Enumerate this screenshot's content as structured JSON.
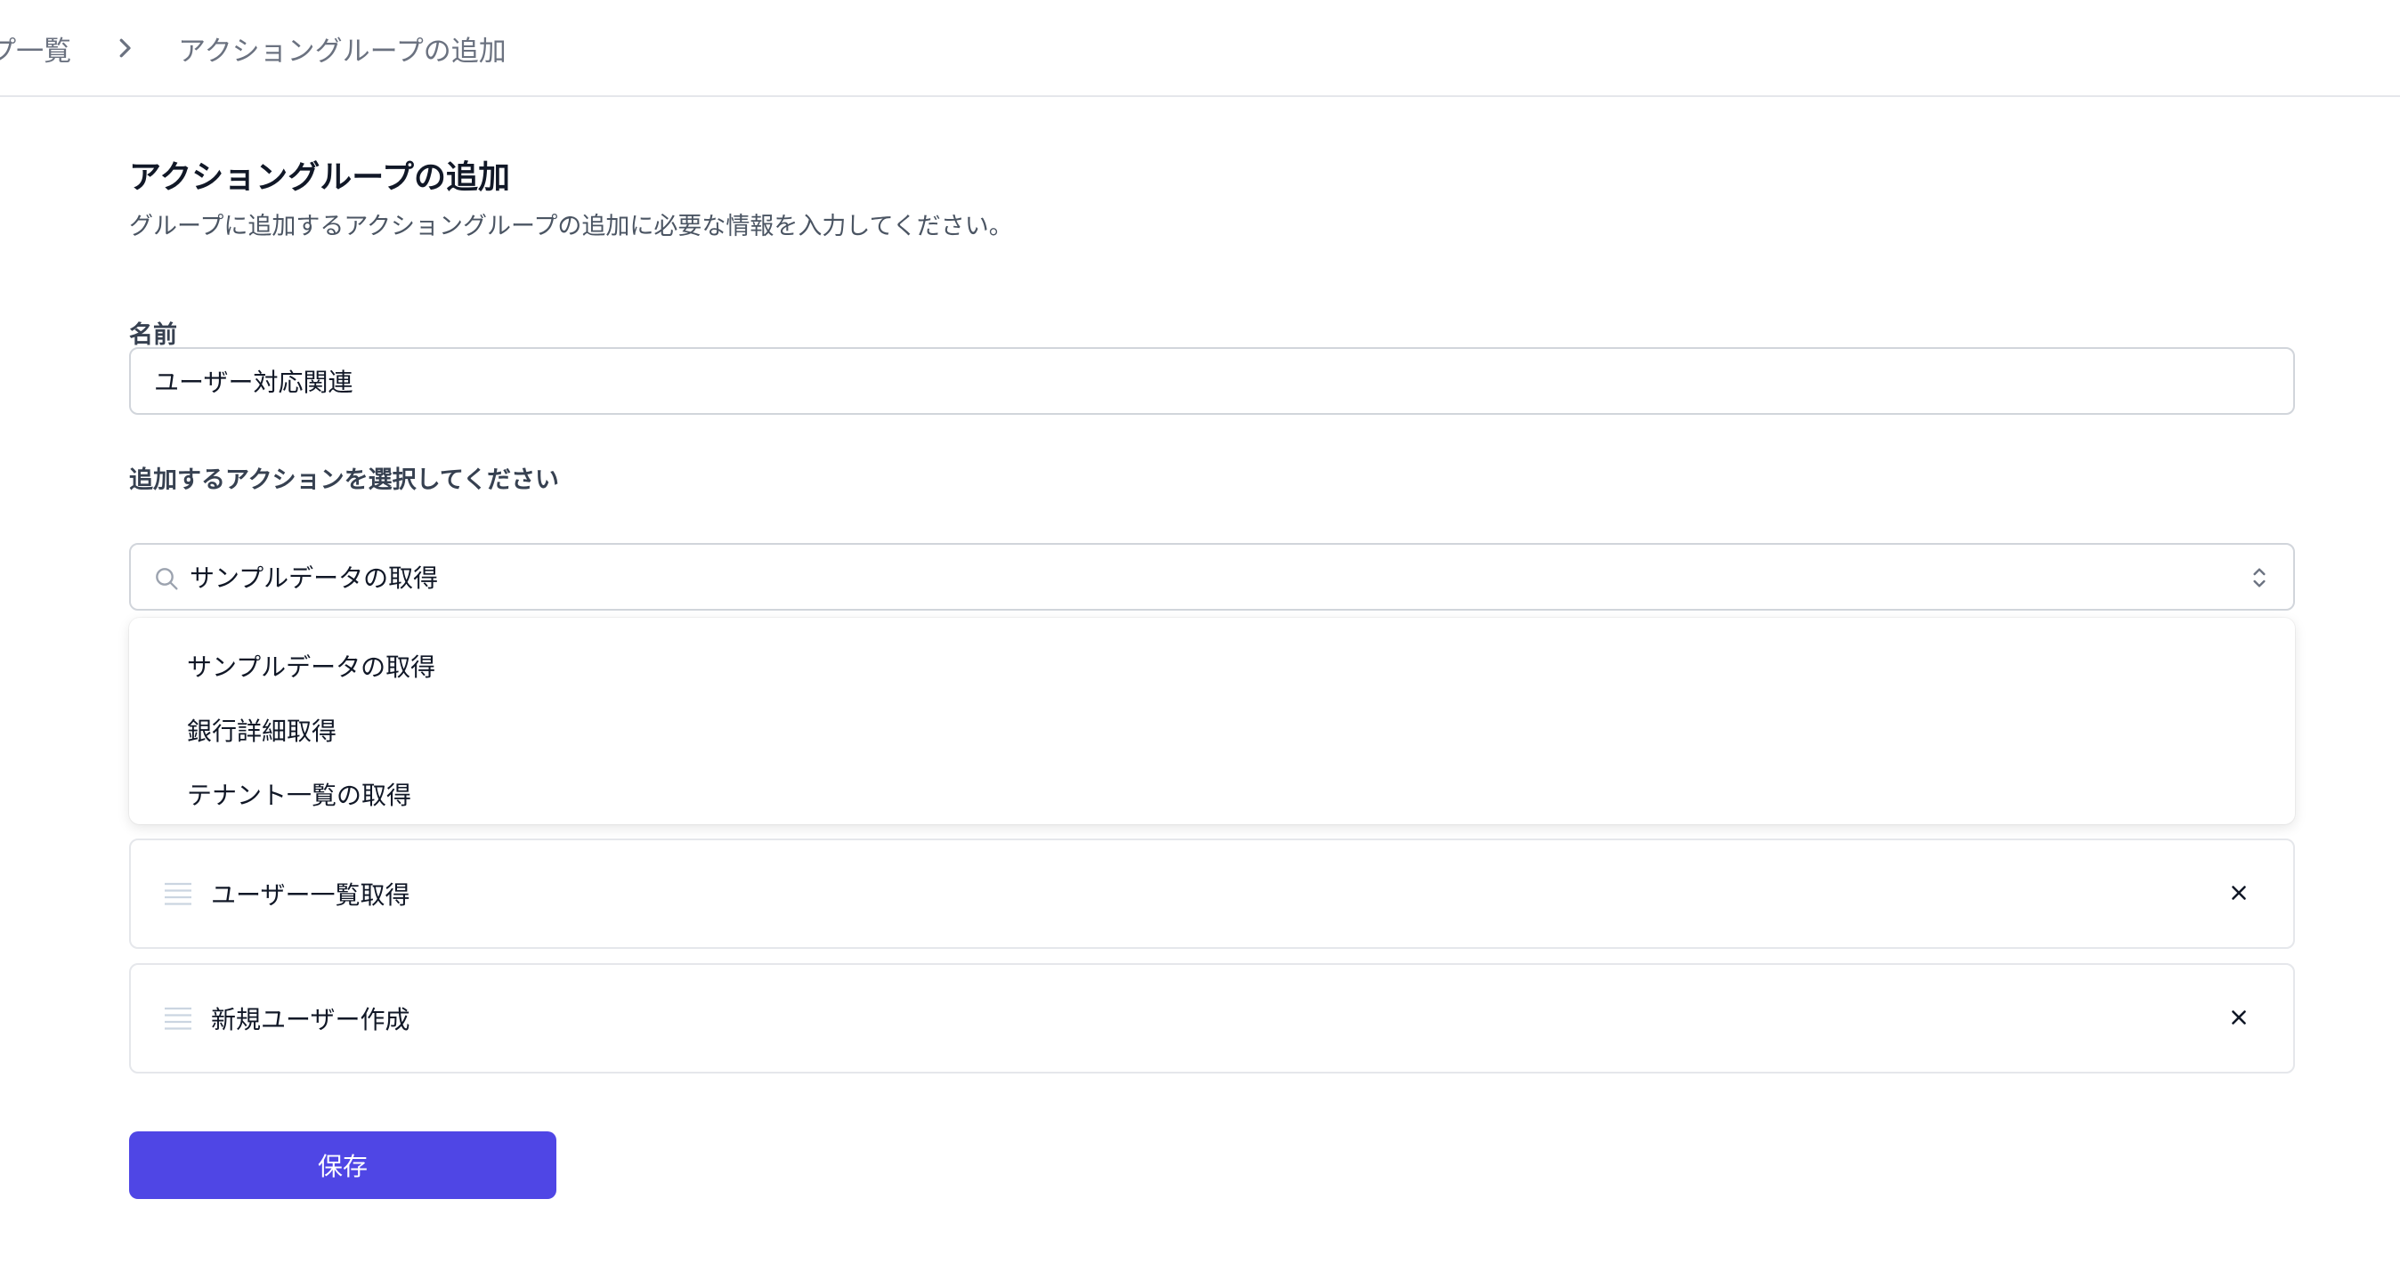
{
  "breadcrumb": {
    "items": [
      "ープ一覧",
      "アクショングループの追加"
    ]
  },
  "page": {
    "title": "アクショングループの追加",
    "description": "グループに追加するアクショングループの追加に必要な情報を入力してください。"
  },
  "form": {
    "name_label": "名前",
    "name_value": "ユーザー対応関連",
    "select_label": "追加するアクションを選択してください",
    "search_value": "サンプルデータの取得",
    "options": [
      "サンプルデータの取得",
      "銀行詳細取得",
      "テナント一覧の取得"
    ],
    "selected_actions": [
      "ユーザー一覧取得",
      "新規ユーザー作成"
    ],
    "save_label": "保存"
  },
  "icons": {
    "breadcrumb_separator": "chevron-right-icon",
    "search": "search-icon",
    "select_toggle": "chevron-up-down-icon",
    "drag_handle": "drag-handle-icon",
    "remove": "close-icon"
  },
  "colors": {
    "primary": "#4f46e5",
    "border": "#d1d5db",
    "muted_text": "#6b7280",
    "drag_handle": "#cbd5e1"
  }
}
